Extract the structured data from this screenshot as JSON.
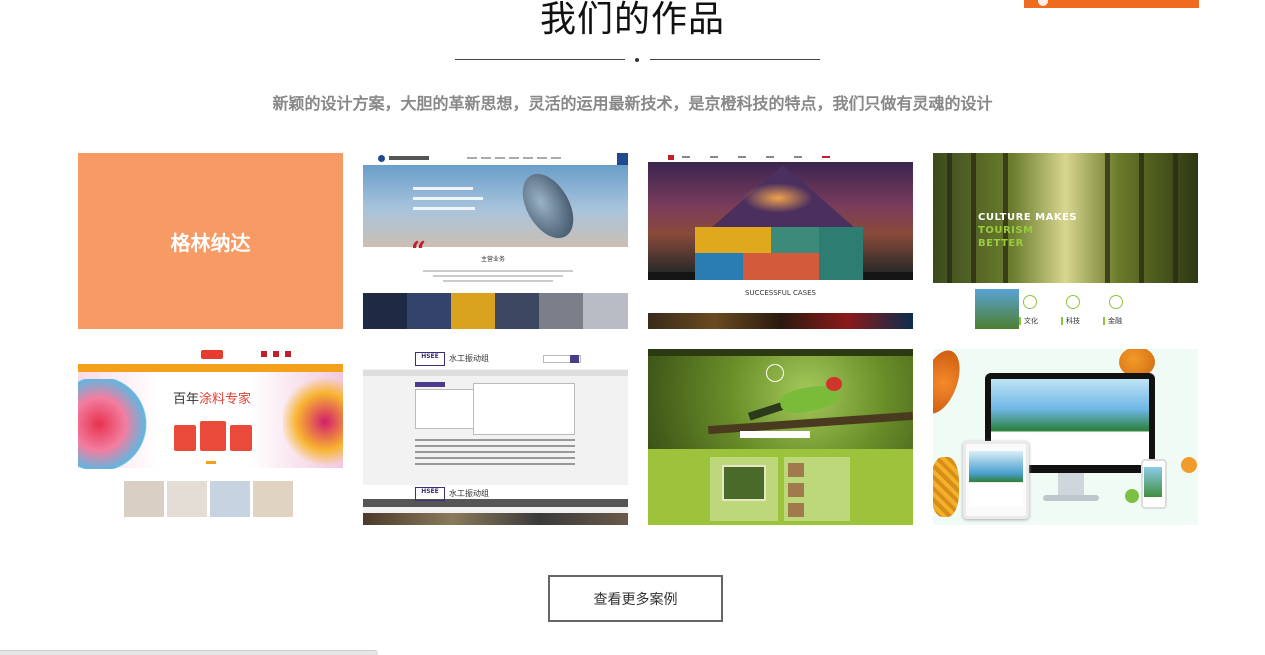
{
  "section": {
    "title": "我们的作品",
    "subtitle": "新颖的设计方案，大胆的革新思想，灵活的运用最新技术，是京橙科技的特点，我们只做有灵魂的设计"
  },
  "cases": [
    {
      "label": "格林纳达",
      "color": "#f79a64"
    },
    {
      "quote_mark": "“",
      "section_title": "主营业务"
    },
    {
      "caption": "SUCCESSFUL CASES"
    },
    {
      "headline_line1": "CULTURE MAKES",
      "headline_line2": "TOURISM",
      "headline_line3": "BETTER",
      "tabs": [
        "文化",
        "科技",
        "金融"
      ]
    },
    {
      "hero_title_prefix": "百年",
      "hero_title_highlight": "涂料专家"
    },
    {
      "logo_text": "HSEE",
      "site_name": "水工振动组"
    },
    {
      "logo_mark": ""
    },
    {
      "device_mockup": true
    }
  ],
  "more_button": {
    "label": "查看更多案例"
  },
  "colors": {
    "accent": "#ee6b1f",
    "card_orange": "#f79a64"
  }
}
